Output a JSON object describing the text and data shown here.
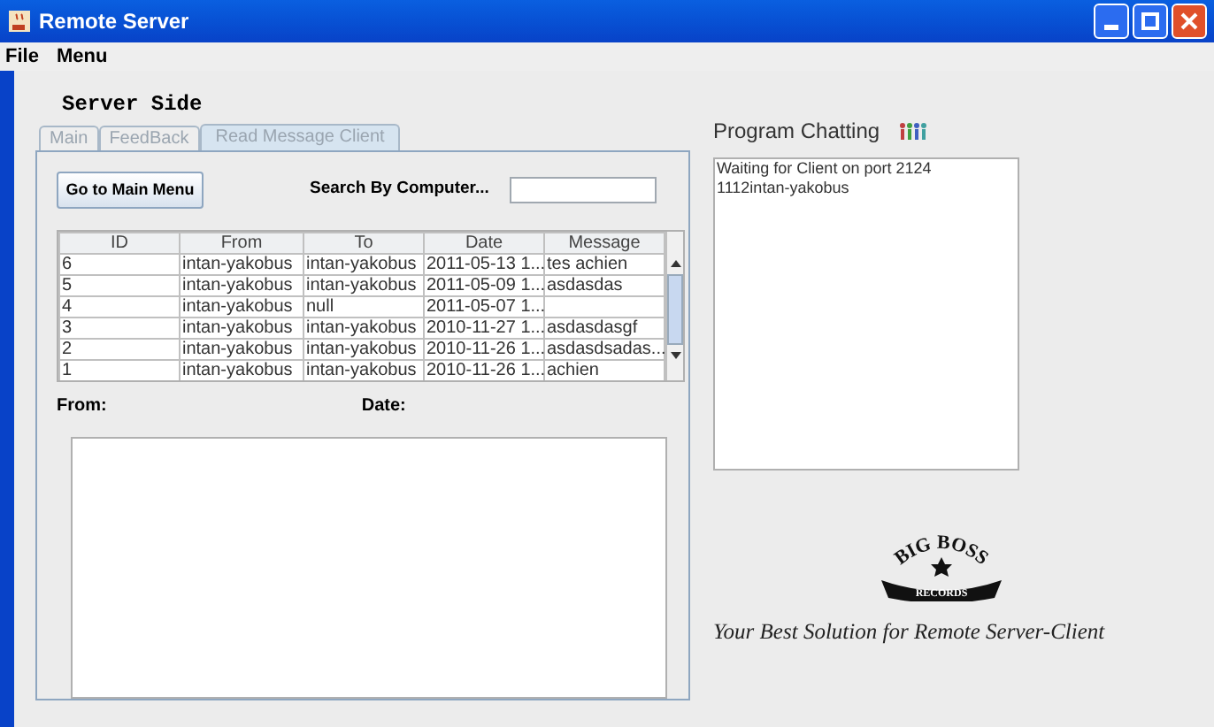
{
  "window": {
    "title": "Remote Server"
  },
  "menu": [
    "File",
    "Menu"
  ],
  "left_panel": {
    "heading": "Server Side",
    "tabs": [
      {
        "label": "Main",
        "selected": false
      },
      {
        "label": "FeedBack",
        "selected": false
      },
      {
        "label": "Read Message Client",
        "selected": true
      }
    ],
    "main_menu_button": "Go to Main Menu",
    "search": {
      "label": "Search By Computer..."
    },
    "table": {
      "columns": [
        "ID",
        "From",
        "To",
        "Date",
        "Message"
      ],
      "rows": [
        [
          "6",
          "intan-yakobus",
          "intan-yakobus",
          "2011-05-13 1...",
          "tes achien"
        ],
        [
          "5",
          "intan-yakobus",
          "intan-yakobus",
          "2011-05-09 1...",
          "asdasdas"
        ],
        [
          "4",
          "intan-yakobus",
          "null",
          "2011-05-07 1...",
          ""
        ],
        [
          "3",
          "intan-yakobus",
          "intan-yakobus",
          "2010-11-27 1...",
          "asdasdasgf"
        ],
        [
          "2",
          "intan-yakobus",
          "intan-yakobus",
          "2010-11-26 1...",
          "asdasdsadas..."
        ],
        [
          "1",
          "intan-yakobus",
          "intan-yakobus",
          "2010-11-26 1...",
          "achien"
        ]
      ]
    },
    "from_label": "From:",
    "date_label": "Date:"
  },
  "right_panel": {
    "title": "Program Chatting",
    "log": [
      "Waiting for Client on port 2124",
      "1112intan-yakobus"
    ],
    "logo": {
      "top": "BIG BOSS",
      "bottom": "RECORDS"
    },
    "tagline": "Your Best Solution for Remote Server-Client"
  }
}
